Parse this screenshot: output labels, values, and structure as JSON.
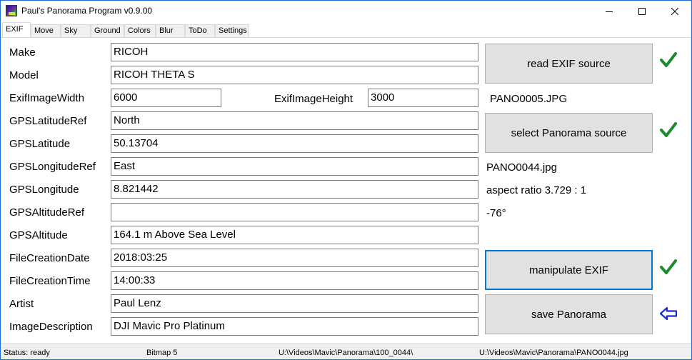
{
  "window": {
    "title": "Paul's Panorama Program v0.9.00"
  },
  "tabs": [
    "EXIF",
    "Move",
    "Sky",
    "Ground",
    "Colors",
    "Blur",
    "ToDo",
    "Settings"
  ],
  "exif": {
    "make": {
      "label": "Make",
      "value": "RICOH"
    },
    "model": {
      "label": "Model",
      "value": "RICOH THETA S"
    },
    "width": {
      "label": "ExifImageWidth",
      "value": "6000"
    },
    "height": {
      "label": "ExifImageHeight",
      "value": "3000"
    },
    "lat_ref": {
      "label": "GPSLatitudeRef",
      "value": "North"
    },
    "lat": {
      "label": "GPSLatitude",
      "value": "50.13704"
    },
    "lon_ref": {
      "label": "GPSLongitudeRef",
      "value": "East"
    },
    "lon": {
      "label": "GPSLongitude",
      "value": "8.821442"
    },
    "alt_ref": {
      "label": "GPSAltitudeRef",
      "value": ""
    },
    "alt": {
      "label": "GPSAltitude",
      "value": "164.1 m Above Sea Level"
    },
    "date": {
      "label": "FileCreationDate",
      "value": "2018:03:25"
    },
    "time": {
      "label": "FileCreationTime",
      "value": "14:00:33"
    },
    "artist": {
      "label": "Artist",
      "value": "Paul Lenz"
    },
    "description": {
      "label": "ImageDescription",
      "value": "DJI Mavic Pro Platinum"
    }
  },
  "actions": {
    "read_exif": "read EXIF source",
    "exif_file": "PANO0005.JPG",
    "select_panorama": "select Panorama source",
    "panorama_file": "PANO0044.jpg",
    "aspect_ratio": "aspect ratio 3.729 : 1",
    "angle": "-76°",
    "manipulate_exif": "manipulate EXIF",
    "save_panorama": "save Panorama"
  },
  "colors": {
    "check": "#1e8a2e",
    "arrow": "#1a2bd6",
    "focus": "#0078d7"
  },
  "icons": {
    "done": "check-icon",
    "next": "arrow-left-icon"
  },
  "status": {
    "state": "Status: ready",
    "bitmap": "Bitmap 5",
    "folder": "U:\\Videos\\Mavic\\Panorama\\100_0044\\",
    "output": "U:\\Videos\\Mavic\\Panorama\\PANO0044.jpg"
  }
}
